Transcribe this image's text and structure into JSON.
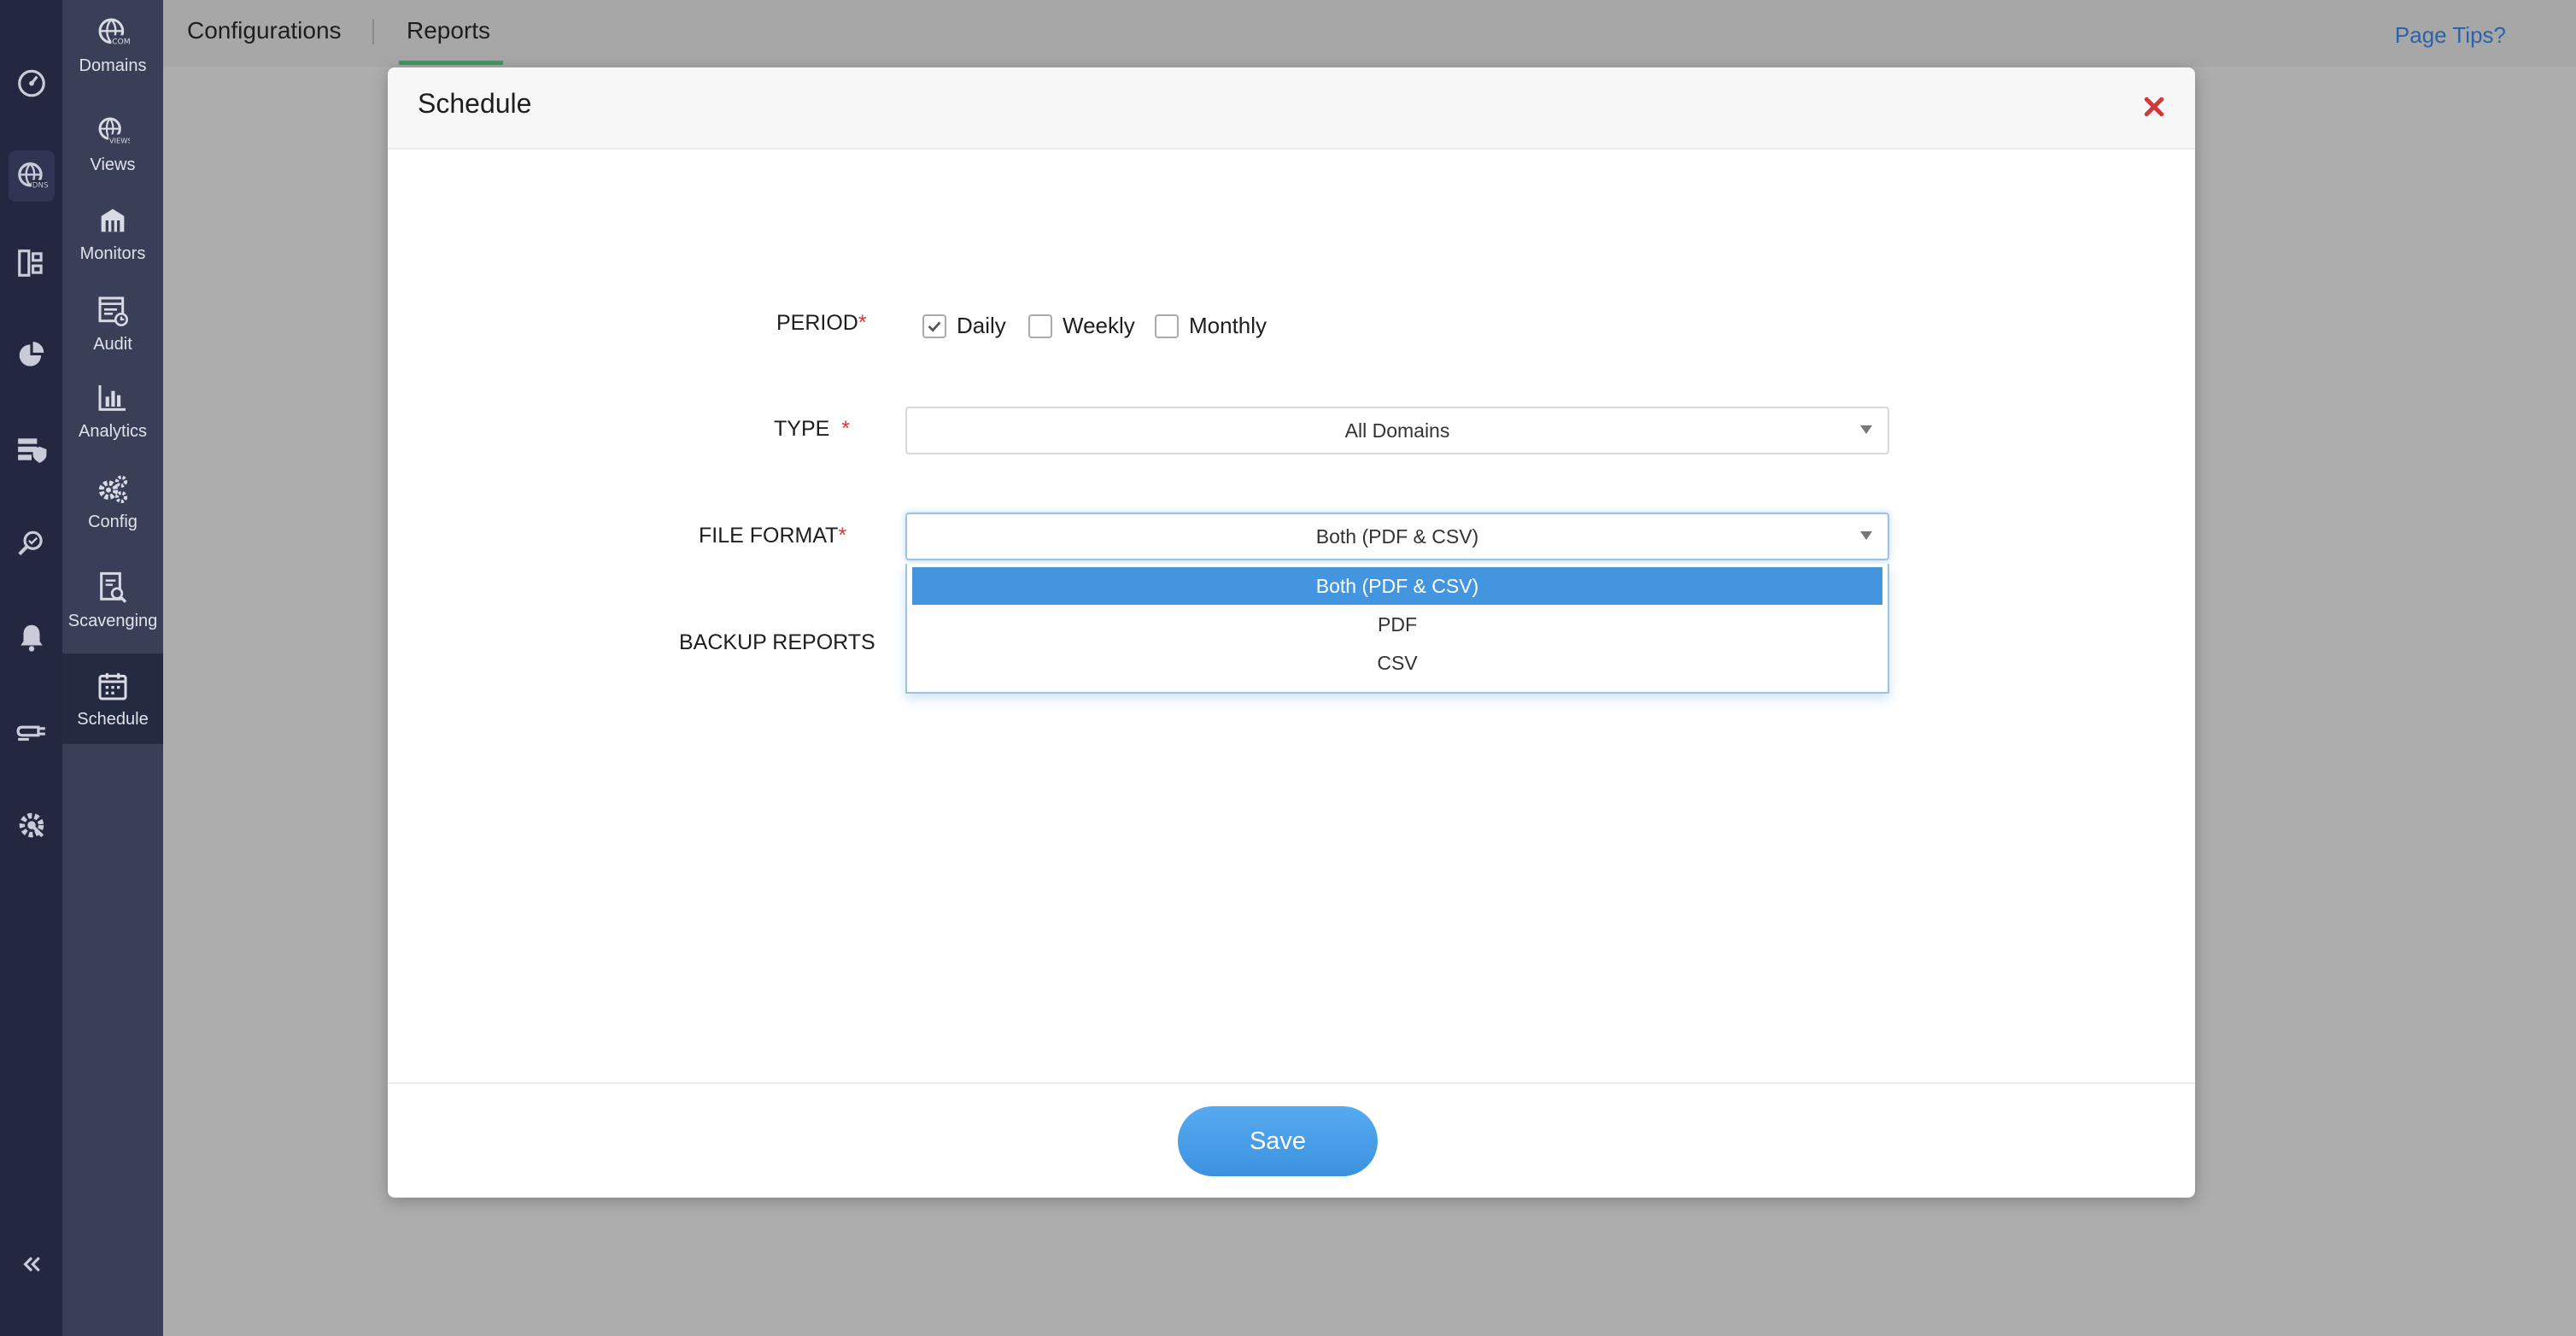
{
  "topbar": {
    "tabs": [
      "Configurations",
      "Reports"
    ],
    "page_tips": "Page Tips?"
  },
  "subnav": {
    "items": [
      {
        "label": "Domains",
        "icon": "globe-com-icon"
      },
      {
        "label": "Views",
        "icon": "globe-views-icon"
      },
      {
        "label": "Monitors",
        "icon": "monitors-icon"
      },
      {
        "label": "Audit",
        "icon": "audit-icon"
      },
      {
        "label": "Analytics",
        "icon": "bar-chart-icon"
      },
      {
        "label": "Config",
        "icon": "gears-icon"
      },
      {
        "label": "Scavenging",
        "icon": "scavenging-icon"
      },
      {
        "label": "Schedule",
        "icon": "calendar-icon"
      }
    ]
  },
  "modal": {
    "title": "Schedule",
    "period": {
      "label": "PERIOD",
      "required": "*",
      "options": [
        {
          "label": "Daily",
          "checked": true
        },
        {
          "label": "Weekly",
          "checked": false
        },
        {
          "label": "Monthly",
          "checked": false
        }
      ]
    },
    "type": {
      "label": "TYPE",
      "required": "*",
      "value": "All Domains"
    },
    "file_format": {
      "label": "FILE FORMAT",
      "required": "*",
      "value": "Both (PDF & CSV)",
      "options": [
        "Both (PDF & CSV)",
        "PDF",
        "CSV"
      ],
      "selected_index": 0
    },
    "backup_reports": {
      "label": "BACKUP REPORTS"
    },
    "save_label": "Save"
  },
  "colors": {
    "accent": "#4495e0",
    "required": "#d23a3a",
    "close": "#d23a3a",
    "active_tab_underline": "#3a9d5d",
    "rail_bg": "#232840",
    "subnav_bg": "#3a3f58"
  }
}
